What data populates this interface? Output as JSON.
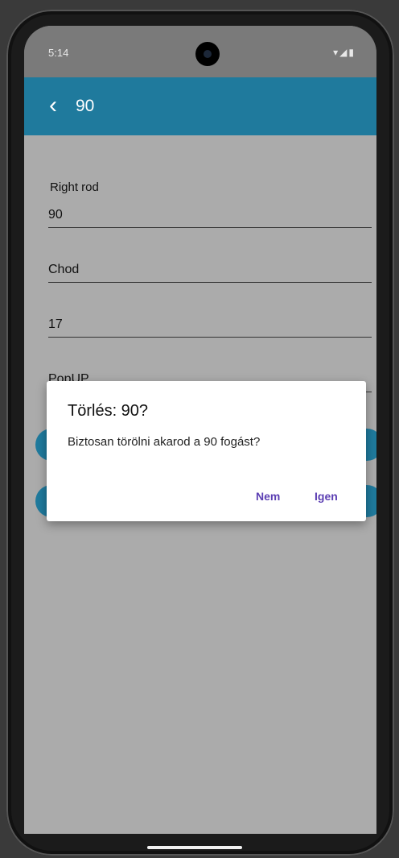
{
  "status": {
    "time": "5:14",
    "icons": "▾◢▮"
  },
  "app_bar": {
    "title": "90"
  },
  "form": {
    "section_label": "Right rod",
    "fields": [
      "90",
      "Chod",
      "17",
      "PopUP"
    ]
  },
  "dialog": {
    "title": "Törlés: 90?",
    "message": "Biztosan törölni akarod a 90 fogást?",
    "cancel_label": "Nem",
    "confirm_label": "Igen"
  },
  "colors": {
    "accent": "#1f7a9d",
    "dialog_button": "#5c3fb3"
  }
}
